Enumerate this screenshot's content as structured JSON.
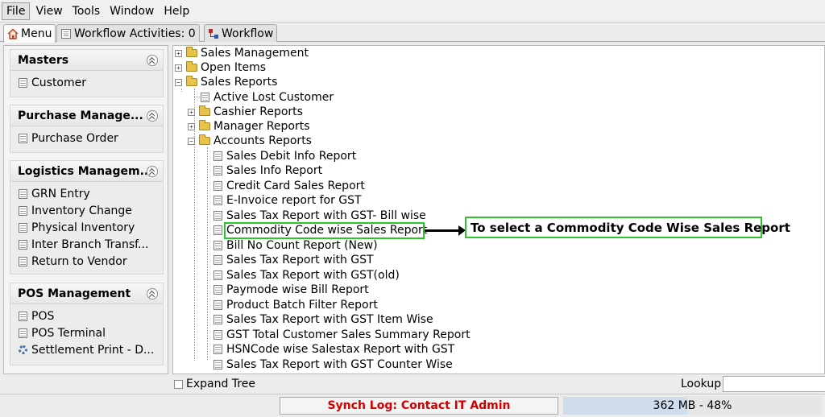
{
  "menubar": {
    "items": [
      "File",
      "View",
      "Tools",
      "Window",
      "Help"
    ]
  },
  "tabs": [
    {
      "label": "Menu",
      "icon": "home-icon"
    },
    {
      "label": "Workflow Activities: 0",
      "icon": "workflow-activities-icon"
    },
    {
      "label": "Workflow",
      "icon": "workflow-icon"
    }
  ],
  "sidebar": {
    "sections": [
      {
        "title": "Masters",
        "items": [
          "Customer"
        ]
      },
      {
        "title": "Purchase Manage...",
        "items": [
          "Purchase Order"
        ]
      },
      {
        "title": "Logistics Managem...",
        "items": [
          "GRN Entry",
          "Inventory Change",
          "Physical Inventory",
          "Inter Branch Transf...",
          "Return to Vendor"
        ]
      },
      {
        "title": "POS Management",
        "items": [
          "POS",
          "POS Terminal",
          "Settlement Print - D..."
        ]
      }
    ]
  },
  "tree": {
    "nodes": [
      {
        "label": "Sales Management",
        "type": "folder",
        "expanded": false
      },
      {
        "label": "Open Items",
        "type": "folder",
        "expanded": false
      },
      {
        "label": "Sales Reports",
        "type": "folder",
        "expanded": true
      },
      {
        "label": "Active Lost Customer",
        "type": "leaf"
      },
      {
        "label": "Cashier Reports",
        "type": "folder",
        "expanded": false
      },
      {
        "label": "Manager Reports",
        "type": "folder",
        "expanded": false
      },
      {
        "label": "Accounts Reports",
        "type": "folder",
        "expanded": true
      },
      {
        "label": "Sales Debit Info Report",
        "type": "leaf"
      },
      {
        "label": "Sales Info Report",
        "type": "leaf"
      },
      {
        "label": "Credit Card Sales Report",
        "type": "leaf"
      },
      {
        "label": "E-Invoice report for GST",
        "type": "leaf"
      },
      {
        "label": "Sales Tax Report with GST- Bill wise",
        "type": "leaf"
      },
      {
        "label": "Commodity Code wise Sales Report",
        "type": "leaf",
        "highlighted": true
      },
      {
        "label": "Bill No Count Report (New)",
        "type": "leaf"
      },
      {
        "label": "Sales Tax Report with GST",
        "type": "leaf"
      },
      {
        "label": "Sales Tax Report with GST(old)",
        "type": "leaf"
      },
      {
        "label": "Paymode wise Bill Report",
        "type": "leaf"
      },
      {
        "label": "Product Batch Filter Report",
        "type": "leaf"
      },
      {
        "label": "Sales Tax Report with GST Item Wise",
        "type": "leaf"
      },
      {
        "label": "GST Total Customer Sales Summary Report",
        "type": "leaf"
      },
      {
        "label": "HSNCode wise Salestax Report with GST",
        "type": "leaf"
      },
      {
        "label": "Sales Tax Report with GST Counter Wise",
        "type": "leaf"
      }
    ]
  },
  "annotation": {
    "text": "To select a Commodity Code Wise Sales Report",
    "highlight_color": "#2cc52c"
  },
  "bottom": {
    "expand_tree_label": "Expand Tree",
    "lookup_label": "Lookup",
    "lookup_value": ""
  },
  "status": {
    "synch_log": "Synch Log: Contact IT Admin",
    "synch_color": "#d10000",
    "memory": "362 MB - 48%",
    "memory_fraction": 0.48
  }
}
